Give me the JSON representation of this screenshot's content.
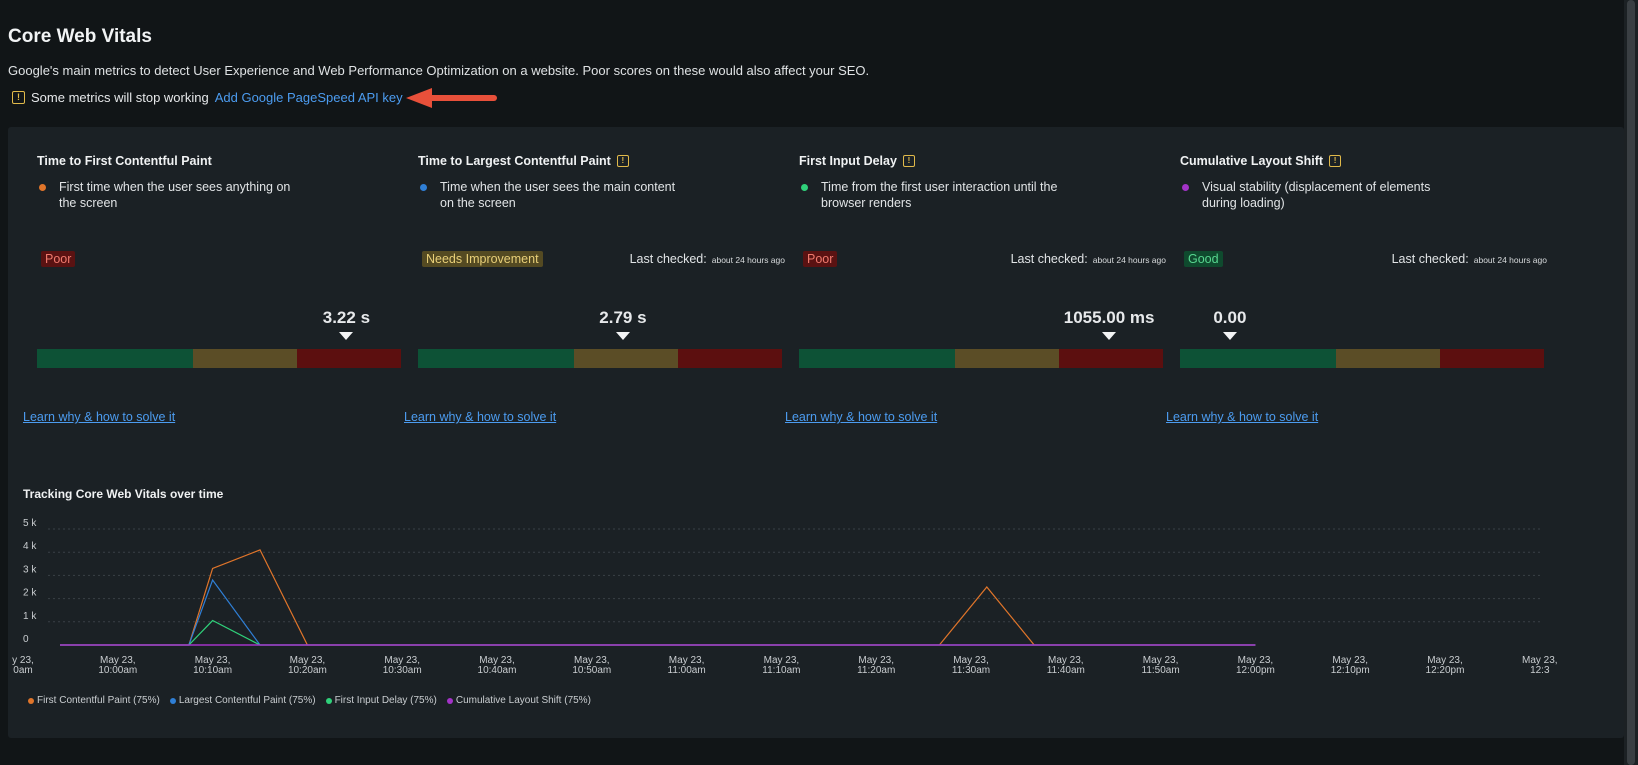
{
  "page": {
    "title": "Core Web Vitals",
    "subtitle": "Google's main metrics to detect User Experience and Web Performance Optimization on a website. Poor scores on these would also affect your SEO.",
    "warning_text": "Some metrics will stop working",
    "warning_link": "Add Google PageSpeed API key",
    "warning_icon": "!"
  },
  "colors": {
    "fcp": "#e0752a",
    "lcp": "#2f7fd6",
    "fid": "#2fd17a",
    "cls": "#a333c8",
    "link": "#4c9cf0"
  },
  "cards": [
    {
      "title": "Time to First Contentful Paint",
      "description": "First time when the user sees anything on the screen",
      "badge": "Poor",
      "last_checked_label": "",
      "last_checked_value": "",
      "value": "3.22 s",
      "position_fraction": 0.85,
      "learn": "Learn why & how to solve it"
    },
    {
      "title": "Time to Largest Contentful Paint",
      "description": "Time when the user sees the main content on the screen",
      "badge": "Needs Improvement",
      "last_checked_label": "Last checked:",
      "last_checked_value": "about 24 hours ago",
      "value": "2.79 s",
      "position_fraction": 0.563,
      "learn": "Learn why & how to solve it"
    },
    {
      "title": "First Input Delay",
      "description": "Time from the first user interaction until the browser renders",
      "badge": "Poor",
      "last_checked_label": "Last checked:",
      "last_checked_value": "about 24 hours ago",
      "value": "1055.00 ms",
      "position_fraction": 0.852,
      "learn": "Learn why & how to solve it"
    },
    {
      "title": "Cumulative Layout Shift",
      "description": "Visual stability (displacement of elements during loading)",
      "badge": "Good",
      "last_checked_label": "Last checked:",
      "last_checked_value": "about 24 hours ago",
      "value": "0.00",
      "position_fraction": 0.137,
      "learn": "Learn why & how to solve it"
    }
  ],
  "chart_data": {
    "type": "line",
    "title": "Tracking Core Web Vitals over time",
    "y_ticks": [
      "5 k",
      "4 k",
      "3 k",
      "2 k",
      "1 k",
      "0"
    ],
    "ylim": [
      0,
      5000
    ],
    "x_ticks": [
      [
        "y 23,",
        "0am"
      ],
      [
        "May 23,",
        "10:00am"
      ],
      [
        "May 23,",
        "10:10am"
      ],
      [
        "May 23,",
        "10:20am"
      ],
      [
        "May 23,",
        "10:30am"
      ],
      [
        "May 23,",
        "10:40am"
      ],
      [
        "May 23,",
        "10:50am"
      ],
      [
        "May 23,",
        "11:00am"
      ],
      [
        "May 23,",
        "11:10am"
      ],
      [
        "May 23,",
        "11:20am"
      ],
      [
        "May 23,",
        "11:30am"
      ],
      [
        "May 23,",
        "11:40am"
      ],
      [
        "May 23,",
        "11:50am"
      ],
      [
        "May 23,",
        "12:00pm"
      ],
      [
        "May 23,",
        "12:10pm"
      ],
      [
        "May 23,",
        "12:20pm"
      ],
      [
        "May 23,",
        "12:3"
      ]
    ],
    "series": [
      {
        "name": "First Contentful Paint (75%)",
        "color_key": "fcp",
        "points": [
          [
            -2,
            0
          ],
          [
            10.5,
            0
          ],
          [
            12.0,
            3300
          ],
          [
            15.0,
            4100
          ],
          [
            18.0,
            0
          ],
          [
            58.0,
            0
          ],
          [
            61.0,
            2500
          ],
          [
            64.0,
            0
          ],
          [
            78.0,
            0
          ]
        ]
      },
      {
        "name": "Largest Contentful Paint (75%)",
        "color_key": "lcp",
        "points": [
          [
            -2,
            0
          ],
          [
            10.5,
            0
          ],
          [
            12.0,
            2800
          ],
          [
            15.0,
            0
          ],
          [
            78.0,
            0
          ]
        ]
      },
      {
        "name": "First Input Delay (75%)",
        "color_key": "fid",
        "points": [
          [
            -2,
            0
          ],
          [
            10.5,
            0
          ],
          [
            12.0,
            1055
          ],
          [
            15.0,
            0
          ],
          [
            78.0,
            0
          ]
        ]
      },
      {
        "name": "Cumulative Layout Shift (75%)",
        "color_key": "cls",
        "points": [
          [
            -2,
            0
          ],
          [
            78.0,
            0
          ]
        ]
      }
    ]
  }
}
